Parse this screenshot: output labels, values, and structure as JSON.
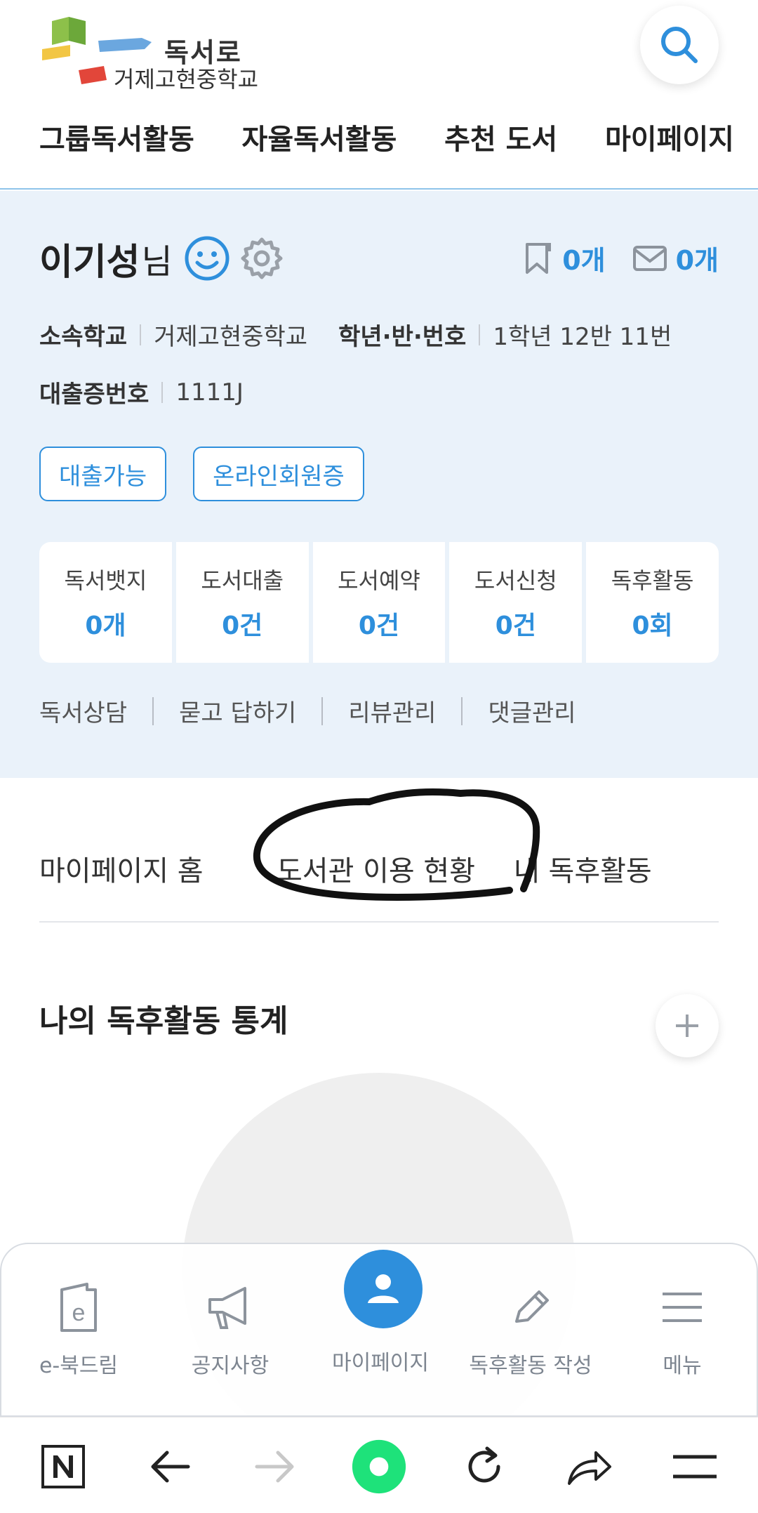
{
  "header": {
    "logo_title": "독서로",
    "logo_subtitle": "거제고현중학교",
    "search_icon": "search-icon",
    "gnb": [
      "그룹독서활동",
      "자율독서활동",
      "추천 도서",
      "마이페이지"
    ]
  },
  "profile": {
    "name": "이기성",
    "name_suffix": "님",
    "bookmark_count": "0개",
    "message_count": "0개",
    "school_label": "소속학교",
    "school_value": "거제고현중학교",
    "grade_label": "학년·반·번호",
    "grade_value": "1학년 12반 11번",
    "card_label": "대출증번호",
    "card_value": "1111J",
    "tags": [
      "대출가능",
      "온라인회원증"
    ],
    "stats": [
      {
        "label": "독서뱃지",
        "value": "0개"
      },
      {
        "label": "도서대출",
        "value": "0건"
      },
      {
        "label": "도서예약",
        "value": "0건"
      },
      {
        "label": "도서신청",
        "value": "0건"
      },
      {
        "label": "독후활동",
        "value": "0회"
      }
    ],
    "links": [
      "독서상담",
      "묻고 답하기",
      "리뷰관리",
      "댓글관리"
    ]
  },
  "tabs": [
    "마이페이지 홈",
    "도서관 이용 현황",
    "내 독후활동"
  ],
  "section": {
    "title": "나의 독후활동 통계"
  },
  "app_nav": [
    {
      "label": "e-북드림",
      "icon": "ebook-icon"
    },
    {
      "label": "공지사항",
      "icon": "megaphone-icon"
    },
    {
      "label": "마이페이지",
      "icon": "user-icon"
    },
    {
      "label": "독후활동 작성",
      "icon": "pencil-icon"
    },
    {
      "label": "메뉴",
      "icon": "hamburger-icon"
    }
  ],
  "browser_bar": {
    "icons": [
      "naver-n-icon",
      "back-arrow-icon",
      "forward-arrow-icon",
      "home-circle-icon",
      "refresh-icon",
      "share-icon",
      "browser-menu-icon"
    ]
  },
  "colors": {
    "accent": "#2e8fdc",
    "profile_bg": "#eaf2fa",
    "green": "#1ee27a"
  }
}
